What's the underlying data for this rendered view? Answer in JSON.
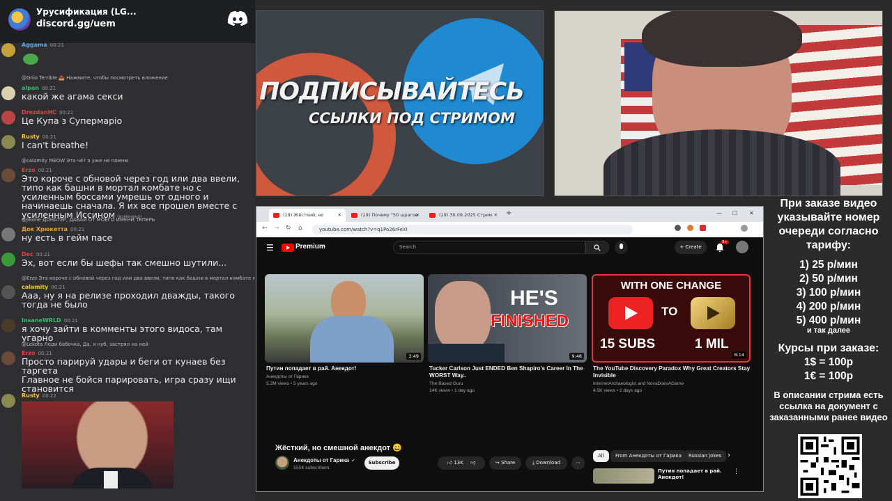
{
  "discord": {
    "server_name": "Урусификация (LG...",
    "invite": "discord.gg/uem",
    "messages": [
      {
        "user": "Aggama",
        "time": "00:21",
        "text": "",
        "color": "#5ba8f0"
      },
      {
        "reply": "@Gnio Terrible 📤 Нажмите, чтобы посмотреть вложение"
      },
      {
        "user": "alpan",
        "time": "00:21",
        "text": "какой же агама секси",
        "color": "#3fb870"
      },
      {
        "user": "DrezdanHC",
        "time": "00:21",
        "text": "Це Купа з Супермаріо",
        "color": "#e0464a"
      },
      {
        "user": "Rusty",
        "time": "00:21",
        "text": "I can't breathe!",
        "color": "#f5c542"
      },
      {
        "reply": "@calamity MEOW Это чё? я уже не помню"
      },
      {
        "user": "Erzo",
        "time": "00:21",
        "text": "Это короче с обновой через год или два ввели, типо как башни в мортал комбате но с усиленным боссами умрешь от одного и начинаешь сначала. Я их все прошел вместе с усиленным Иссином",
        "color": "#e0464a",
        "edited": "(изменено)"
      },
      {
        "reply": "@jikone ДОНАТЕР, ДАВАЙ ОТ МОЕГО ИМЕНИ ТЕПЕРЬ"
      },
      {
        "user": "Док Хрюкетта",
        "time": "00:21",
        "text": "ну есть в гейм пасе",
        "color": "#f0a030"
      },
      {
        "user": "Dec",
        "time": "00:21",
        "text": "Эх, вот если бы шефы так смешно шутили...",
        "color": "#e0464a"
      },
      {
        "reply": "@Erzo Это короче с обновой через год или два ввели, типо как башни в мортал комбате но с усил"
      },
      {
        "user": "calamity",
        "time": "00:21",
        "text": "Ааа, ну я на релизе проходил дважды, такого тогда не было",
        "color": "#f5c542"
      },
      {
        "user": "InsaneWRLD",
        "time": "00:21",
        "text": "я хочу зайти в комменты этого видоса, там угарно",
        "color": "#3fb870"
      },
      {
        "reply": "@Lekota Леди бабочка, Да, я нуб, застрял на ней"
      },
      {
        "user": "Erzo",
        "time": "00:21",
        "text": "Просто парируй удары и беги от кунаев без таргета\nГлавное не бойся парировать, игра сразу ищи\nстановится",
        "color": "#e0464a"
      },
      {
        "user": "Rusty",
        "time": "00:22",
        "text": "",
        "color": "#f5c542"
      }
    ]
  },
  "banner": {
    "title": "ПОДПИСЫВАЙТЕСЬ",
    "subtitle": "ССЫЛКИ ПОД СТРИМОМ"
  },
  "browser": {
    "tabs": [
      "(19) Жёсткий, но смешной ...",
      "(19) Почему \"50 шрагов Амер...",
      "(19) 30.09.2025 Стрим Стиме..."
    ],
    "url": "youtube.com/watch?v=q1Po26rFeXI",
    "logo_text": "Premium",
    "search_placeholder": "Search",
    "create_label": "Create",
    "bell_badge": "9+",
    "cards": [
      {
        "title": "Путин попадает в рай. Анекдот!",
        "channel": "Анекдоты от Гарика",
        "stats": "5.2M views • 5 years ago",
        "duration": "3:49"
      },
      {
        "title": "Tucker Carlson Just ENDED Ben Shapiro's Career In The WORST Way..",
        "channel": "The Based Guru",
        "stats": "14K views • 1 day ago",
        "duration": "9:48",
        "thumb_text1": "HE'S",
        "thumb_text2": "FINISHED"
      },
      {
        "title": "The YouTube Discovery Paradox Why Great Creators Stay Invisible",
        "channel": "InternetArchaeologist and NovaDoesAGame",
        "stats": "4.5K views • 2 days ago",
        "duration": "8:14",
        "thumb_top": "WITH ONE CHANGE",
        "thumb_to": "TO",
        "thumb_left": "15 SUBS",
        "thumb_right": "1 MIL"
      }
    ],
    "now_playing": {
      "title": "Жёсткий, но смешной анекдот 😄",
      "channel": "Анекдоты от Гарика",
      "subs": "555K subscribers",
      "subscribe": "Subscribe",
      "likes": "13K",
      "share": "Share",
      "download": "Download"
    },
    "chips": [
      "All",
      "From Анекдоты от Гарика",
      "Russian jokes"
    ],
    "side_title": "Путин попадает в рай. Анекдот!"
  },
  "info": {
    "heading": "При заказе видео указывайте номер очереди согласно тарифу:",
    "prices": [
      "1) 25 р/мин",
      "2) 50 р/мин",
      "3) 100 р/мин",
      "4) 200 р/мин",
      "5) 400 р/мин"
    ],
    "etc": "и так далее",
    "rates_heading": "Курсы при заказе:",
    "rates": [
      "1$ = 100р",
      "1€ = 100р"
    ],
    "note": "В описании стрима есть ссылка на документ с заказанными ранее видео"
  }
}
